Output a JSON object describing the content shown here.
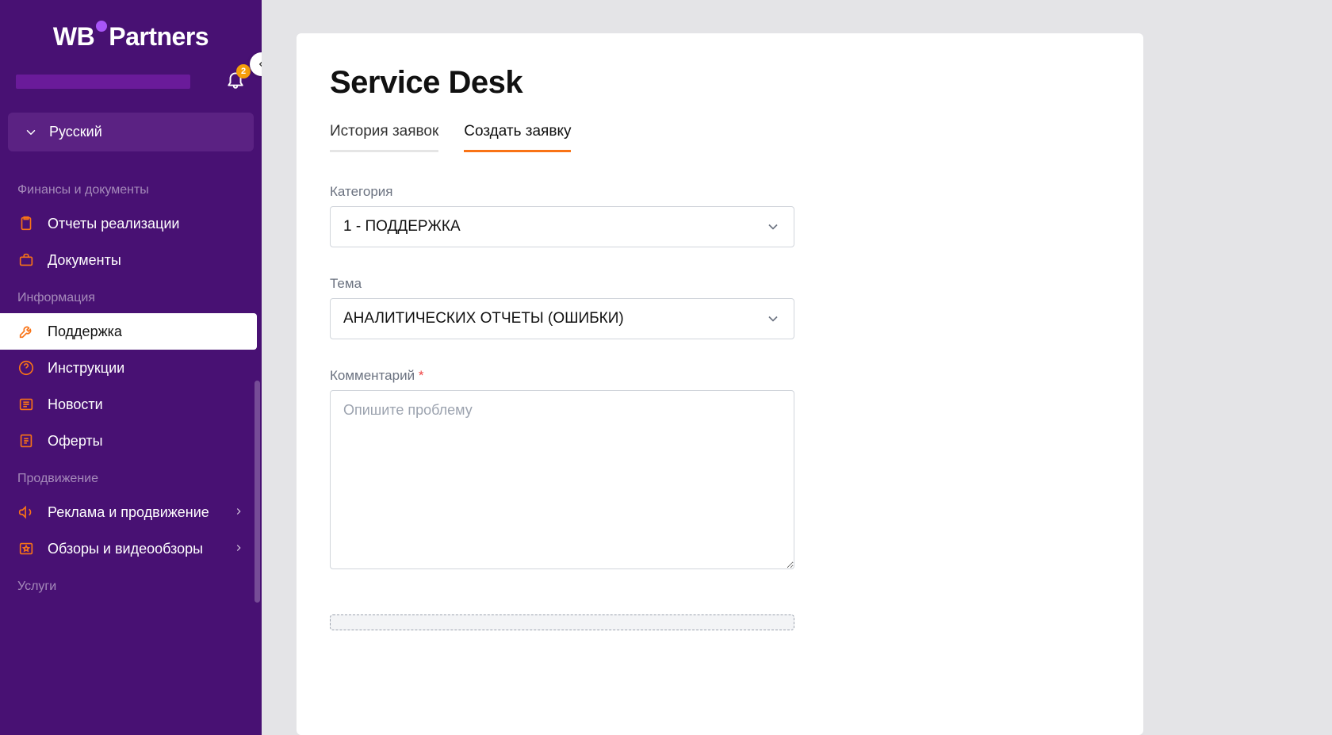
{
  "logo": {
    "prefix": "WB",
    "suffix": "Partners"
  },
  "notifications": {
    "count": "2"
  },
  "language": {
    "current": "Русский"
  },
  "sidebar": {
    "sections": [
      {
        "header": "Финансы и документы",
        "items": [
          {
            "label": "Отчеты реализации",
            "icon": "clipboard-icon",
            "chevron": false,
            "active": false
          },
          {
            "label": "Документы",
            "icon": "briefcase-icon",
            "chevron": false,
            "active": false
          }
        ]
      },
      {
        "header": "Информация",
        "items": [
          {
            "label": "Поддержка",
            "icon": "wrench-icon",
            "chevron": false,
            "active": true
          },
          {
            "label": "Инструкции",
            "icon": "question-icon",
            "chevron": false,
            "active": false
          },
          {
            "label": "Новости",
            "icon": "news-icon",
            "chevron": false,
            "active": false
          },
          {
            "label": "Оферты",
            "icon": "document-icon",
            "chevron": false,
            "active": false
          }
        ]
      },
      {
        "header": "Продвижение",
        "items": [
          {
            "label": "Реклама и продвижение",
            "icon": "megaphone-icon",
            "chevron": true,
            "active": false
          },
          {
            "label": "Обзоры и видеообзоры",
            "icon": "star-icon",
            "chevron": true,
            "active": false
          }
        ]
      },
      {
        "header": "Услуги",
        "items": []
      }
    ]
  },
  "main": {
    "title": "Service Desk",
    "tabs": [
      {
        "label": "История заявок",
        "active": false
      },
      {
        "label": "Создать заявку",
        "active": true
      }
    ],
    "form": {
      "category_label": "Категория",
      "category_value": "1 - ПОДДЕРЖКА",
      "topic_label": "Тема",
      "topic_value": "АНАЛИТИЧЕСКИХ ОТЧЕТЫ (ОШИБКИ)",
      "comment_label": "Комментарий",
      "comment_placeholder": "Опишите проблему"
    }
  }
}
